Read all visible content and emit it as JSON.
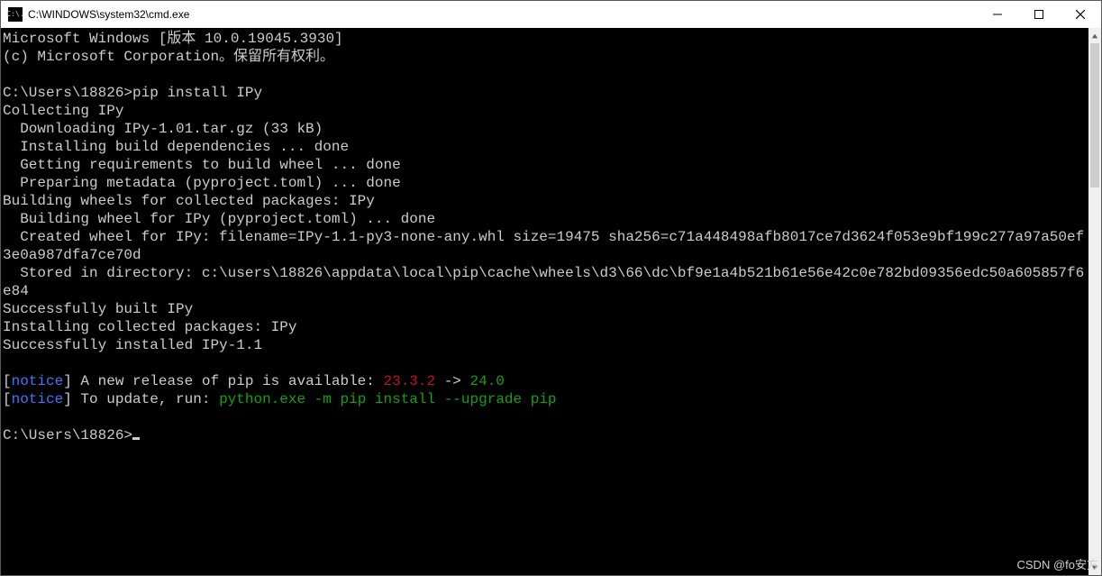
{
  "window": {
    "title": "C:\\WINDOWS\\system32\\cmd.exe",
    "icon_label": "C:\\."
  },
  "terminal": {
    "header_line": "Microsoft Windows [版本 10.0.19045.3930]",
    "copyright_line": "(c) Microsoft Corporation。保留所有权利。",
    "prompt1_path": "C:\\Users\\18826>",
    "prompt1_cmd": "pip install IPy",
    "lines": {
      "collecting": "Collecting IPy",
      "downloading": "  Downloading IPy-1.01.tar.gz (33 kB)",
      "install_deps": "  Installing build dependencies ... done",
      "get_reqs": "  Getting requirements to build wheel ... done",
      "prep_meta": "  Preparing metadata (pyproject.toml) ... done",
      "building_header": "Building wheels for collected packages: IPy",
      "building_wheel": "  Building wheel for IPy (pyproject.toml) ... done",
      "created_wheel": "  Created wheel for IPy: filename=IPy-1.1-py3-none-any.whl size=19475 sha256=c71a448498afb8017ce7d3624f053e9bf199c277a97a50ef3e0a987dfa7ce70d",
      "stored_dir": "  Stored in directory: c:\\users\\18826\\appdata\\local\\pip\\cache\\wheels\\d3\\66\\dc\\bf9e1a4b521b61e56e42c0e782bd09356edc50a605857f6e84",
      "built_ok": "Successfully built IPy",
      "installing": "Installing collected packages: IPy",
      "installed_ok": "Successfully installed IPy-1.1"
    },
    "notice1": {
      "open": "[",
      "tag": "notice",
      "close": "]",
      "text": " A new release of pip is available: ",
      "old_ver": "23.3.2",
      "arrow": " -> ",
      "new_ver": "24.0"
    },
    "notice2": {
      "open": "[",
      "tag": "notice",
      "close": "]",
      "text": " To update, run: ",
      "cmd": "python.exe -m pip install --upgrade pip"
    },
    "prompt2_path": "C:\\Users\\18826>"
  },
  "watermark": "CSDN @fo安方"
}
